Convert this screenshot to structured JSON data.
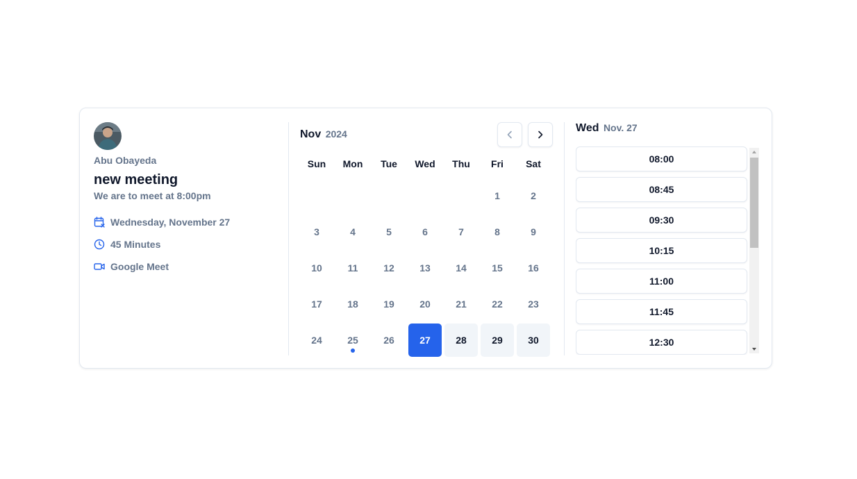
{
  "host": {
    "name": "Abu Obayeda"
  },
  "event": {
    "title": "new meeting",
    "description": "We are to meet at 8:00pm",
    "details": [
      {
        "icon": "calendar-icon",
        "text": "Wednesday, November 27"
      },
      {
        "icon": "clock-icon",
        "text": "45 Minutes"
      },
      {
        "icon": "video-icon",
        "text": "Google Meet"
      }
    ]
  },
  "calendar": {
    "month": "Nov",
    "year": "2024",
    "weekdays": [
      "Sun",
      "Mon",
      "Tue",
      "Wed",
      "Thu",
      "Fri",
      "Sat"
    ],
    "first_weekday_index": 5,
    "days_in_month": 30,
    "selected_day": 27,
    "available_days": [
      28,
      29,
      30
    ],
    "today_marker_day": 25
  },
  "times": {
    "weekday": "Wed",
    "date": "Nov. 27",
    "slots": [
      "08:00",
      "08:45",
      "09:30",
      "10:15",
      "11:00",
      "11:45",
      "12:30"
    ]
  },
  "colors": {
    "accent": "#2563eb",
    "muted_text": "#64748b",
    "available_bg": "#f1f5f9"
  }
}
